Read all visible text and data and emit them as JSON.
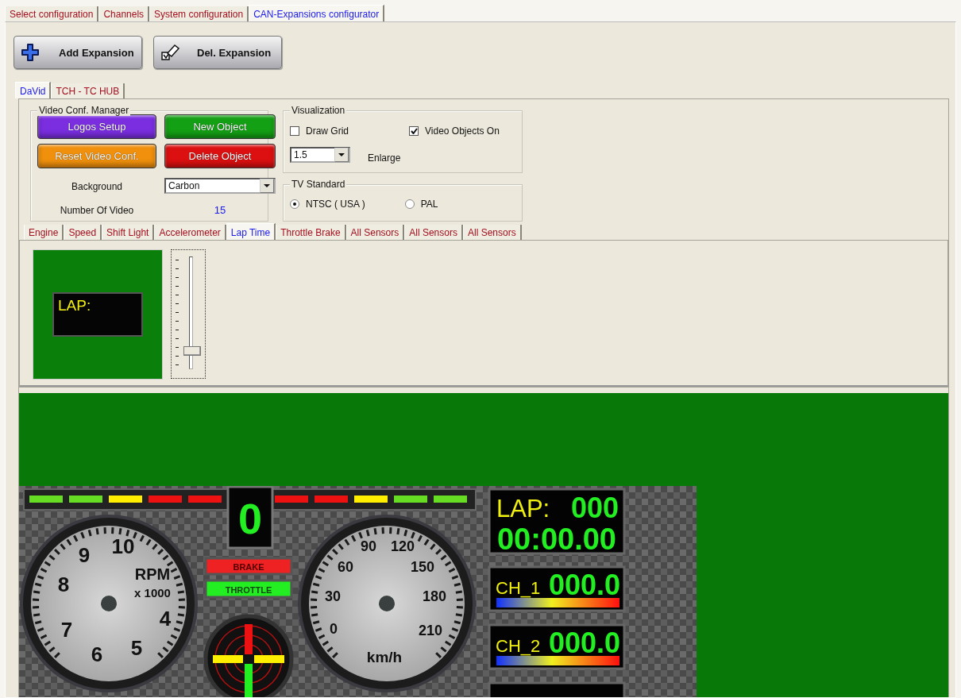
{
  "main_tabs": [
    {
      "label": "Select configuration",
      "selected": false
    },
    {
      "label": "Channels",
      "selected": false
    },
    {
      "label": "System configuration",
      "selected": false
    },
    {
      "label": "CAN-Expansions configurator",
      "selected": true
    }
  ],
  "toolbar": [
    {
      "label": "Add Expansion",
      "kind": "add"
    },
    {
      "label": "Del. Expansion",
      "kind": "delete"
    }
  ],
  "expansion_tabs": [
    {
      "label": "DaVid",
      "selected": true
    },
    {
      "label": "TCH - TC HUB",
      "selected": false
    }
  ],
  "video_conf_manager": {
    "title": "Video Conf. Manager",
    "buttons": [
      {
        "label": "Logos Setup",
        "color": "#7a2ee0"
      },
      {
        "label": "New Object",
        "color": "#14a014"
      },
      {
        "label": "Reset Video Conf.",
        "color": "#f0900c"
      },
      {
        "label": "Delete Object",
        "color": "#dc1010"
      }
    ],
    "background_label": "Background",
    "background_value": "Carbon",
    "video_count_label": "Number Of Video",
    "video_count": "15"
  },
  "visualization": {
    "title": "Visualization",
    "checkboxes": [
      {
        "label": "Draw Grid",
        "checked": false
      },
      {
        "label": "Video Objects On",
        "checked": true
      }
    ],
    "enlarge_value": "1.5",
    "enlarge_label": "Enlarge"
  },
  "tv_standard": {
    "title": "TV Standard",
    "options": [
      {
        "label": "NTSC ( USA )",
        "selected": true
      },
      {
        "label": "PAL",
        "selected": false
      }
    ]
  },
  "object_tabs": [
    {
      "label": "Engine",
      "selected": false
    },
    {
      "label": "Speed",
      "selected": false
    },
    {
      "label": "Shift Light",
      "selected": false
    },
    {
      "label": "Accelerometer",
      "selected": false
    },
    {
      "label": "Lap Time",
      "selected": true
    },
    {
      "label": "Throttle Brake",
      "selected": false
    },
    {
      "label": "All Sensors",
      "selected": false
    },
    {
      "label": "All Sensors",
      "selected": false
    },
    {
      "label": "All Sensors",
      "selected": false
    }
  ],
  "object_preview": {
    "label": "LAP:"
  },
  "size_slider": {
    "level": 0.15
  },
  "dashboard": {
    "shift_lights": [
      {
        "color": "#66dd22"
      },
      {
        "color": "#66dd22"
      },
      {
        "color": "#ffee00"
      },
      {
        "color": "#ee1111"
      },
      {
        "color": "#ee1111"
      },
      {
        "color": "#ee1111"
      },
      {
        "color": "#ee1111"
      },
      {
        "color": "#ffee00"
      },
      {
        "color": "#66dd22"
      },
      {
        "color": "#66dd22"
      }
    ],
    "gear": "0",
    "tachometer": {
      "numbers": [
        "10",
        "9",
        "8",
        "7",
        "6",
        "5",
        "4"
      ],
      "unit": "RPM",
      "multiplier": "x 1000"
    },
    "brake_label": "BRAKE",
    "throttle_label": "THROTTLE",
    "speedometer": {
      "numbers": [
        "0",
        "30",
        "60",
        "90",
        "120",
        "150",
        "180",
        "210"
      ],
      "unit": "km/h"
    },
    "lap": {
      "label": "LAP:",
      "count": "000",
      "time": "00:00.00"
    },
    "channels": [
      {
        "name": "CH_1",
        "value": "000.0"
      },
      {
        "name": "CH_2",
        "value": "000.0"
      }
    ]
  }
}
